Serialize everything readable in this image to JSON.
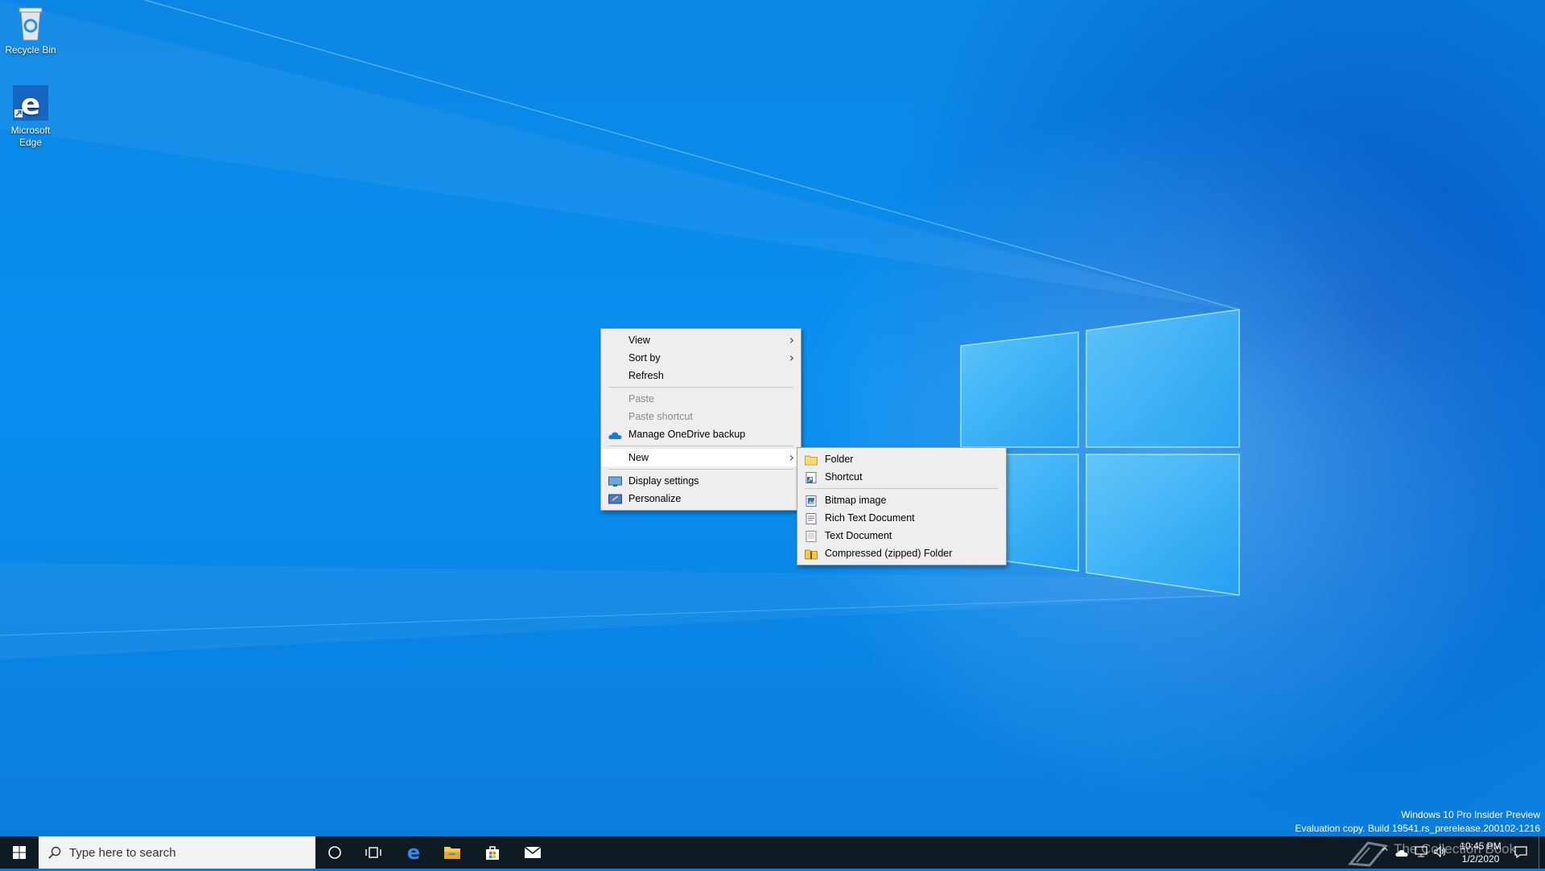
{
  "desktop": {
    "icons": [
      {
        "label": "Recycle Bin"
      },
      {
        "label": "Microsoft Edge"
      }
    ]
  },
  "context_menu": {
    "items": [
      {
        "label": "View",
        "has_submenu": true
      },
      {
        "label": "Sort by",
        "has_submenu": true
      },
      {
        "label": "Refresh"
      },
      {
        "label": "Paste",
        "disabled": true
      },
      {
        "label": "Paste shortcut",
        "disabled": true
      },
      {
        "label": "Manage OneDrive backup",
        "icon": "onedrive-icon"
      },
      {
        "label": "New",
        "has_submenu": true,
        "highlighted": true
      },
      {
        "label": "Display settings",
        "icon": "display-icon"
      },
      {
        "label": "Personalize",
        "icon": "personalize-icon"
      }
    ]
  },
  "submenu_new": {
    "items": [
      {
        "label": "Folder",
        "icon": "folder-icon"
      },
      {
        "label": "Shortcut",
        "icon": "shortcut-icon"
      },
      {
        "label": "Bitmap image",
        "icon": "bitmap-icon"
      },
      {
        "label": "Rich Text Document",
        "icon": "rich-text-icon"
      },
      {
        "label": "Text Document",
        "icon": "text-document-icon"
      },
      {
        "label": "Compressed (zipped) Folder",
        "icon": "zip-folder-icon"
      }
    ]
  },
  "taskbar": {
    "search_placeholder": "Type here to search",
    "clock_time": "10:45 PM",
    "clock_date": "1/2/2020",
    "pinned": [
      "start-icon",
      "cortana-icon",
      "task-view-icon",
      "edge-icon",
      "file-explorer-icon",
      "store-icon",
      "mail-icon"
    ]
  },
  "watermark": {
    "line1": "Windows 10 Pro Insider Preview",
    "line2": "Evaluation copy. Build 19541.rs_prerelease.200102-1216",
    "overlay_text": "The Collection Book"
  },
  "colors": {
    "desktop_blue": "#0a8ff0",
    "taskbar": "#101a22",
    "menu_bg": "#eeeeee",
    "menu_highlight": "#ffffff"
  }
}
